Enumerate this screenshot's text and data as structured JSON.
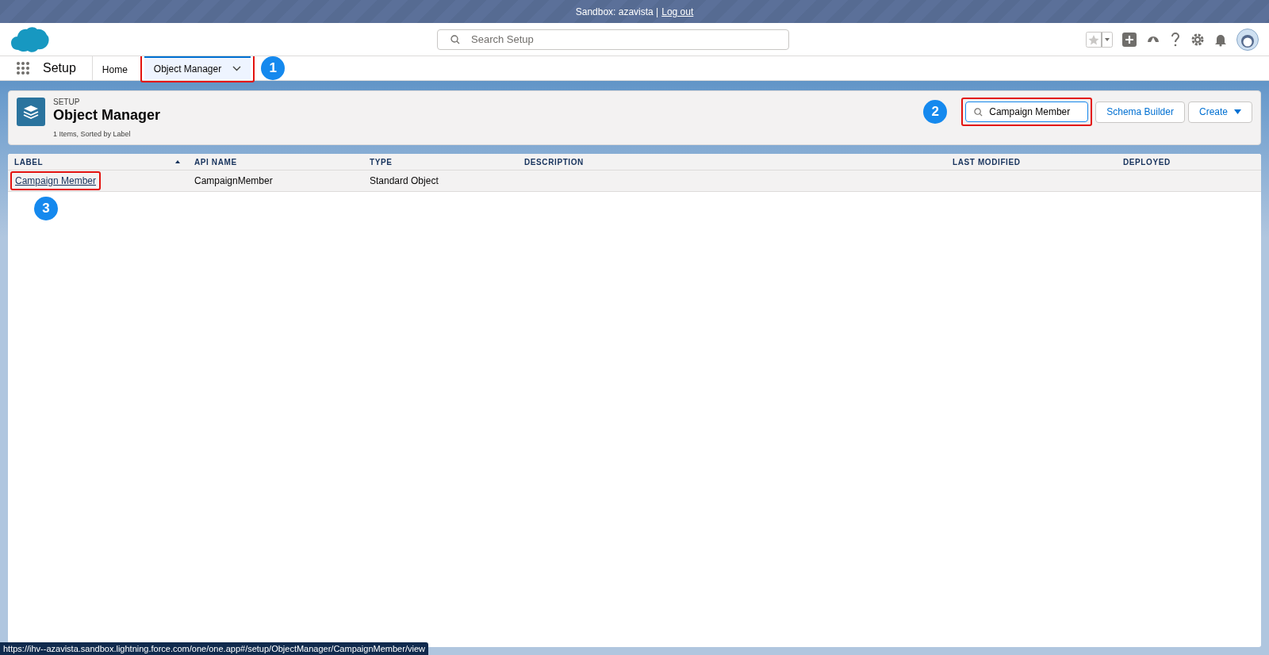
{
  "banner": {
    "text": "Sandbox: azavista |",
    "link": "Log out"
  },
  "header": {
    "search": {
      "placeholder": "Search Setup"
    }
  },
  "nav": {
    "app": "Setup",
    "tabs": [
      {
        "label": "Home",
        "selected": false,
        "dropdown": false
      },
      {
        "label": "Object Manager",
        "selected": true,
        "dropdown": true,
        "callout": "1"
      }
    ]
  },
  "page_header": {
    "eyebrow": "SETUP",
    "title": "Object Manager",
    "meta": "1 Items, Sorted by Label",
    "search": {
      "value": "Campaign Member",
      "callout": "2"
    },
    "buttons": [
      {
        "label": "Schema Builder",
        "kind": "plain"
      },
      {
        "label": "Create",
        "kind": "menu"
      }
    ]
  },
  "table": {
    "columns": [
      {
        "label": "LABEL",
        "sorted": true
      },
      {
        "label": "API NAME",
        "sorted": false
      },
      {
        "label": "TYPE",
        "sorted": false
      },
      {
        "label": "DESCRIPTION",
        "sorted": false
      },
      {
        "label": "LAST MODIFIED",
        "sorted": false
      },
      {
        "label": "DEPLOYED",
        "sorted": false
      }
    ],
    "rows": [
      {
        "cells": [
          "Campaign Member",
          "CampaignMember",
          "Standard Object",
          "",
          "",
          ""
        ],
        "callout": "3"
      }
    ]
  },
  "status_url": "https://ihv--azavista.sandbox.lightning.force.com/one/one.app#/setup/ObjectManager/CampaignMember/view"
}
